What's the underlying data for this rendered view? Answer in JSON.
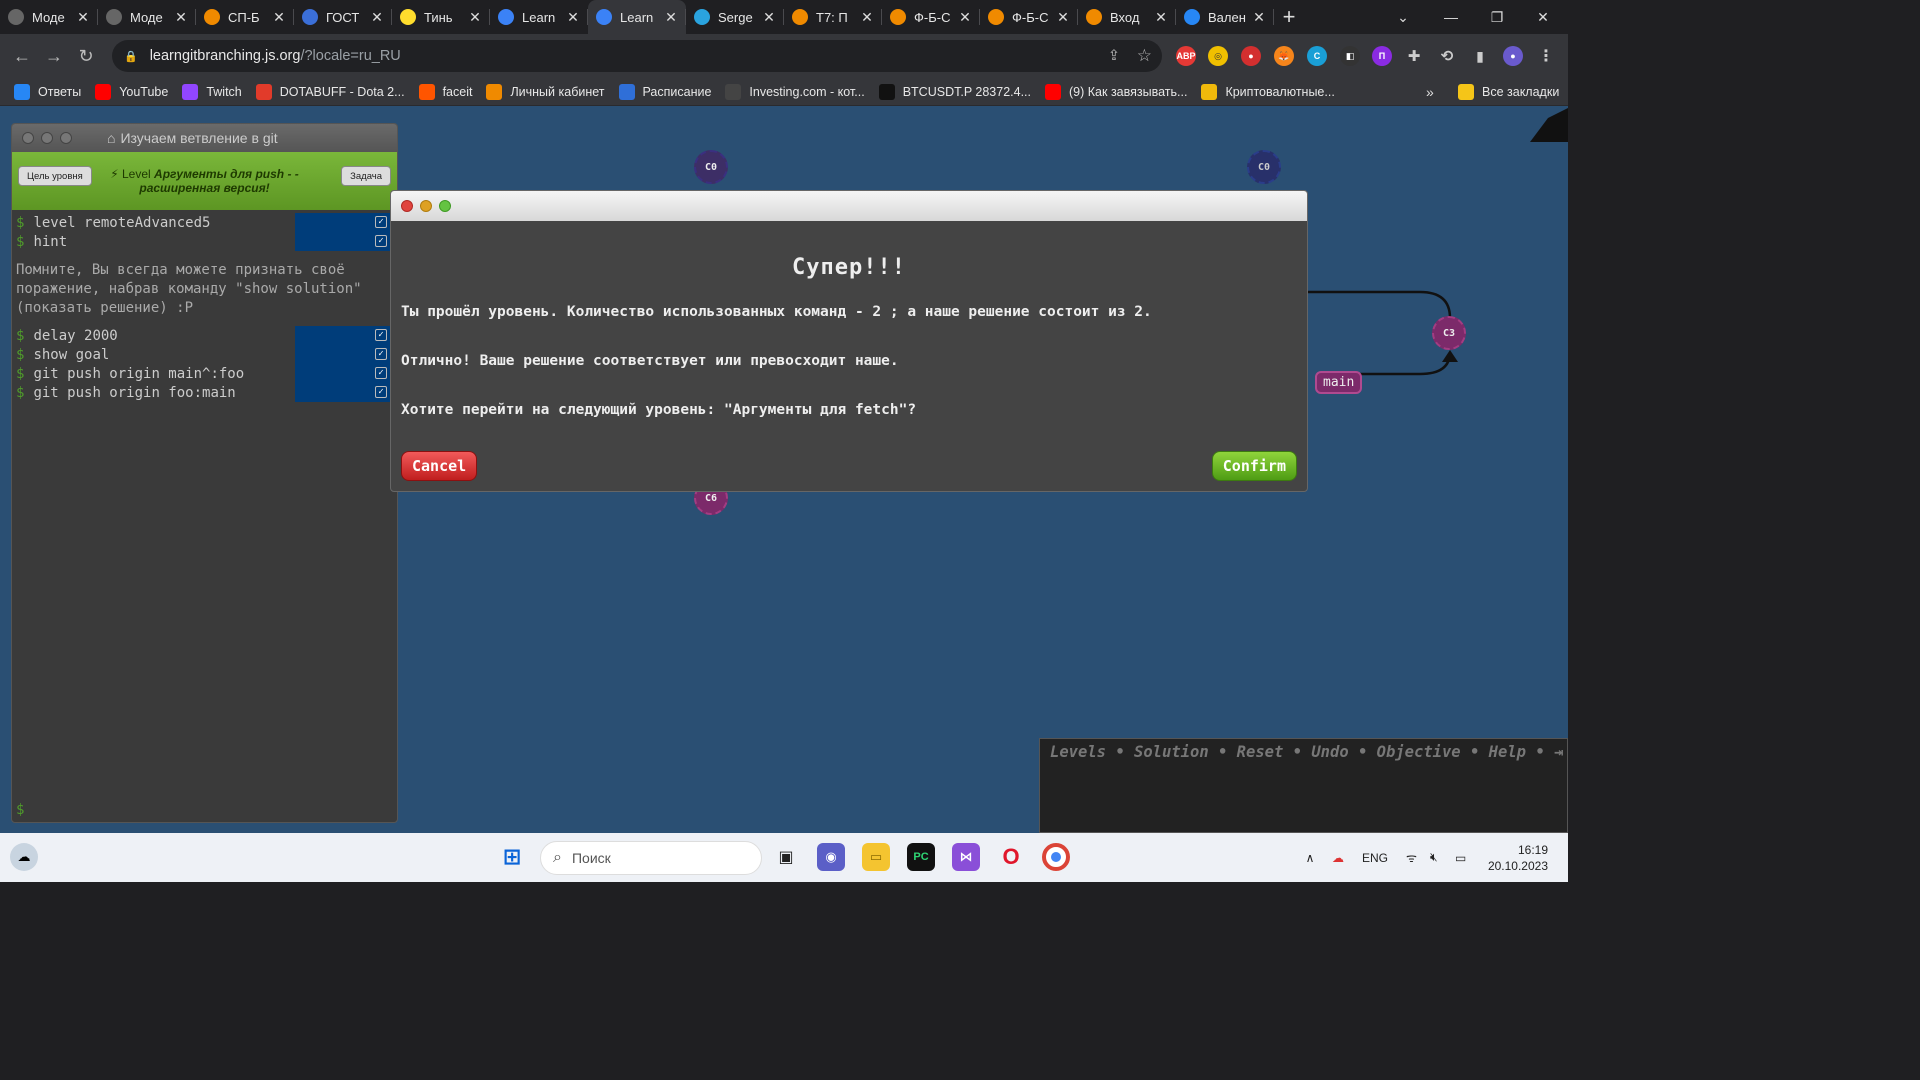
{
  "tabs": [
    {
      "title": "Моде",
      "icon": "globe-icon"
    },
    {
      "title": "Моде",
      "icon": "globe-icon"
    },
    {
      "title": "СП-Б",
      "icon": "tp-icon"
    },
    {
      "title": "ГОСТ",
      "icon": "gost-icon"
    },
    {
      "title": "Тинь",
      "icon": "tinkoff-icon"
    },
    {
      "title": "Learn",
      "icon": "learngit-icon"
    },
    {
      "title": "Learn",
      "icon": "learngit-icon",
      "active": true
    },
    {
      "title": "Serge",
      "icon": "telegram-icon"
    },
    {
      "title": "T7: П",
      "icon": "tp-icon"
    },
    {
      "title": "Ф-Б-С",
      "icon": "tp-icon"
    },
    {
      "title": "Ф-Б-С",
      "icon": "tp-icon"
    },
    {
      "title": "Вход",
      "icon": "tp-icon"
    },
    {
      "title": "Вален",
      "icon": "vk-icon"
    }
  ],
  "address": {
    "host": "learngitbranching.js.org",
    "path": "/?locale=ru_RU"
  },
  "bookmarks": [
    {
      "label": "Ответы",
      "icon": "vk-icon",
      "color": "#2787f5"
    },
    {
      "label": "YouTube",
      "icon": "youtube-icon",
      "color": "#ff0000"
    },
    {
      "label": "Twitch",
      "icon": "twitch-icon",
      "color": "#9146ff"
    },
    {
      "label": "DOTABUFF - Dota 2...",
      "icon": "dotabuff-icon",
      "color": "#e23b2a"
    },
    {
      "label": "faceit",
      "icon": "faceit-icon",
      "color": "#ff5500"
    },
    {
      "label": "Личный кабинет",
      "icon": "tp-icon",
      "color": "#f08a00"
    },
    {
      "label": "Расписание",
      "icon": "schedule-icon",
      "color": "#2f6fd8"
    },
    {
      "label": "Investing.com - кот...",
      "icon": "investing-icon",
      "color": "#444"
    },
    {
      "label": "BTCUSDT.P 28372.4...",
      "icon": "tradingview-icon",
      "color": "#111"
    },
    {
      "label": "(9) Как завязывать...",
      "icon": "youtube-icon",
      "color": "#ff0000"
    },
    {
      "label": "Криптовалютные...",
      "icon": "binance-icon",
      "color": "#f0b90b"
    }
  ],
  "bookmarks_more": "»",
  "all_bookmarks": "Все закладки",
  "terminal": {
    "title": "Изучаем ветвление в git",
    "goal_button": "Цель уровня",
    "task_button": "Задача",
    "level_prefix": "Level",
    "level_name": "Аргументы для push - - расширенная версия!",
    "commands_top": [
      "level remoteAdvanced5",
      "hint"
    ],
    "hint_message": "Помните, Вы всегда можете признать своё поражение, набрав команду \"show solution\" (показать решение) :P",
    "commands_bottom": [
      "delay 2000",
      "show goal",
      "git push origin main^:foo",
      "git push origin foo:main"
    ],
    "prompt": "$"
  },
  "graph": {
    "nodes": [
      "C0",
      "C0",
      "C3",
      "C6"
    ],
    "branches": [
      "main"
    ]
  },
  "dialog": {
    "title": "Супер!!!",
    "line1": "Ты прошёл уровень. Количество использованных команд - 2 ; а наше решение состоит из 2.",
    "line2": "Отлично! Ваше решение соответствует или превосходит наше.",
    "line3": "Хотите перейти на следующий уровень: \"Аргументы для fetch\"?",
    "cancel": "Cancel",
    "confirm": "Confirm"
  },
  "levels_bar": [
    "Levels",
    "Solution",
    "Reset",
    "Undo",
    "Objective",
    "Help"
  ],
  "taskbar": {
    "search_placeholder": "Поиск",
    "lang": "ENG",
    "time": "16:19",
    "date": "20.10.2023"
  }
}
